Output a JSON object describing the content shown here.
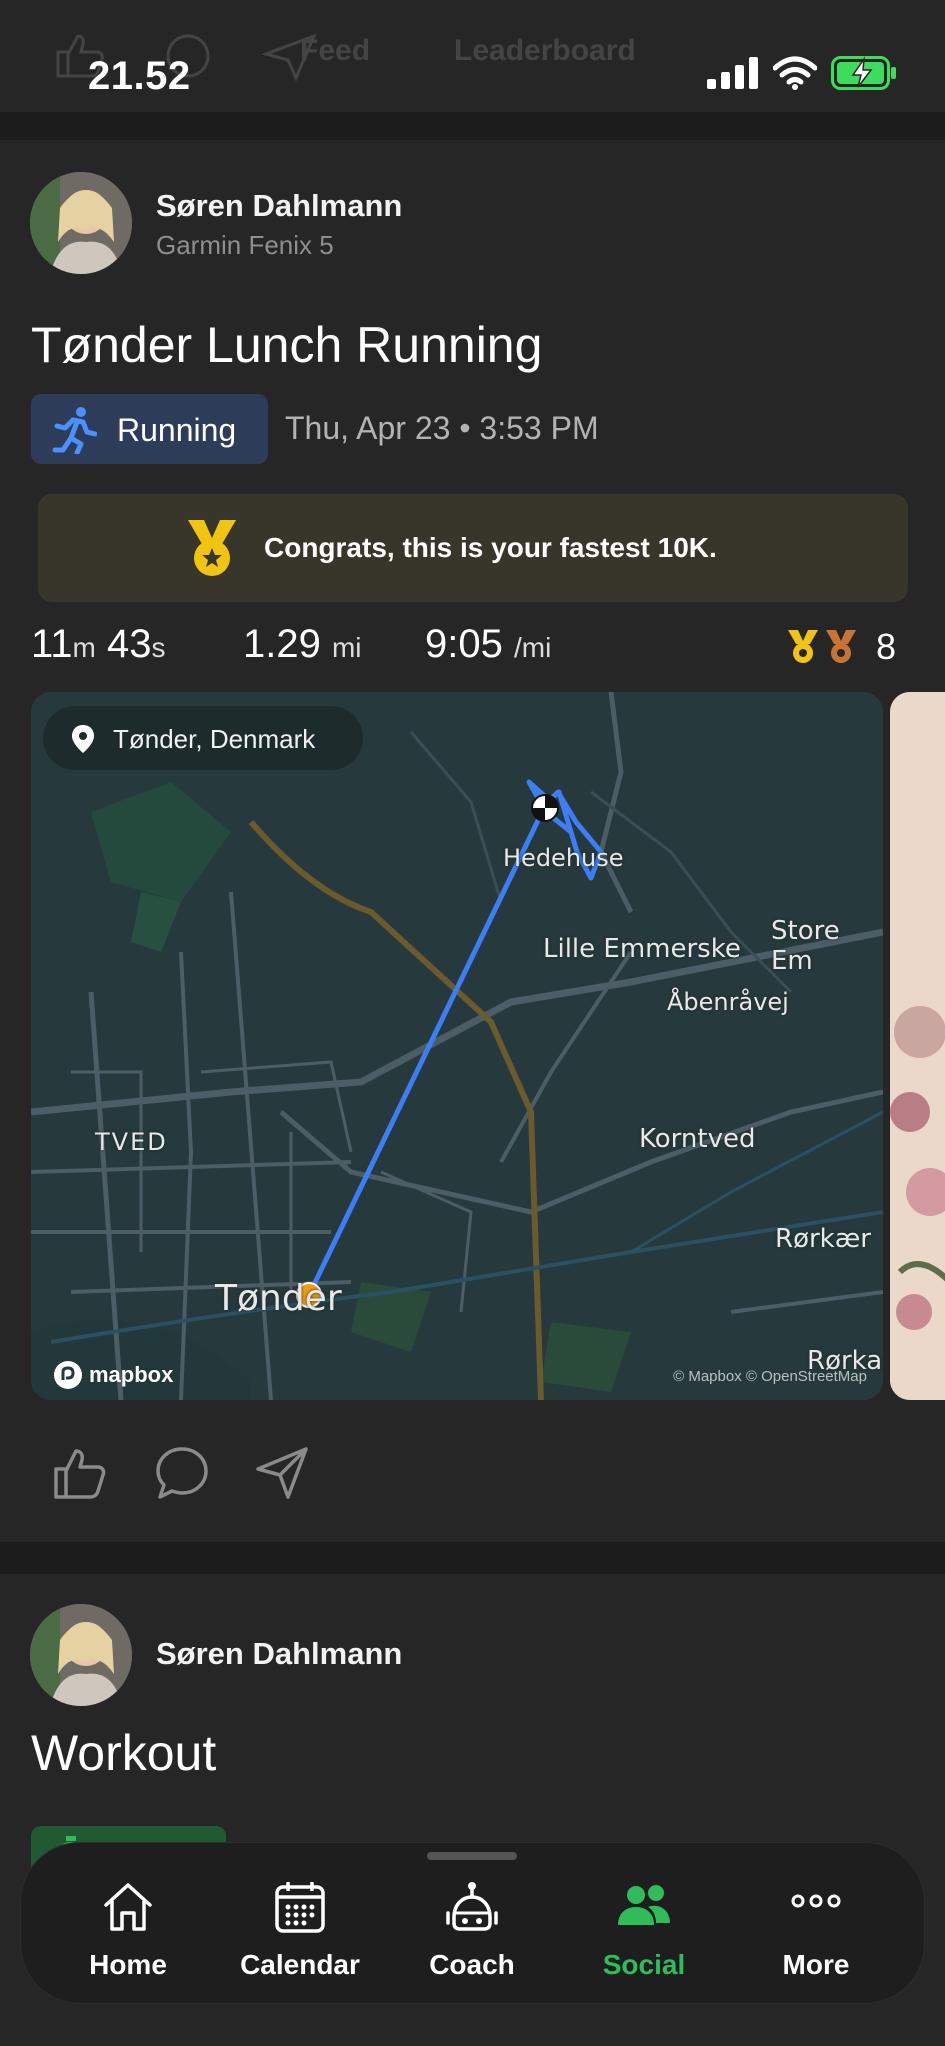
{
  "status_bar": {
    "time": "21.52"
  },
  "top_tabs": {
    "feed": "Feed",
    "leaderboard": "Leaderboard"
  },
  "activity": {
    "user_name": "Søren Dahlmann",
    "device": "Garmin Fenix 5",
    "title": "Tønder Lunch Running",
    "sport": "Running",
    "datetime": "Thu, Apr 23 • 3:53 PM",
    "congrats": "Congrats, this is your fastest 10K.",
    "stats": {
      "min": "11",
      "min_unit": "m",
      "sec": "43",
      "sec_unit": "s",
      "distance": "1.29",
      "distance_unit": "mi",
      "pace": "9:05",
      "pace_unit": "/mi",
      "medal_count": "8"
    },
    "map": {
      "location": "Tønder, Denmark",
      "labels": {
        "hedehuse": "Hedehuse",
        "lille_emmerske": "Lille Emmerske",
        "store_em": "Store Em",
        "abenravej": "Åbenråvej",
        "tved": "TVED",
        "korntved": "Korntved",
        "rorkaer": "Rørkær",
        "rorka": "Rørka",
        "tonder": "Tønder"
      },
      "logo": "mapbox",
      "attribution": "© Mapbox © OpenStreetMap"
    }
  },
  "second_post": {
    "user_name": "Søren Dahlmann",
    "title": "Workout"
  },
  "tab_bar": {
    "items": [
      {
        "label": "Home"
      },
      {
        "label": "Calendar"
      },
      {
        "label": "Coach"
      },
      {
        "label": "Social"
      },
      {
        "label": "More"
      }
    ]
  },
  "colors": {
    "accent": "#2ebd59",
    "route": "#3d7df5",
    "medal_gold": "#f1c40f",
    "medal_bronze": "#c87533"
  }
}
